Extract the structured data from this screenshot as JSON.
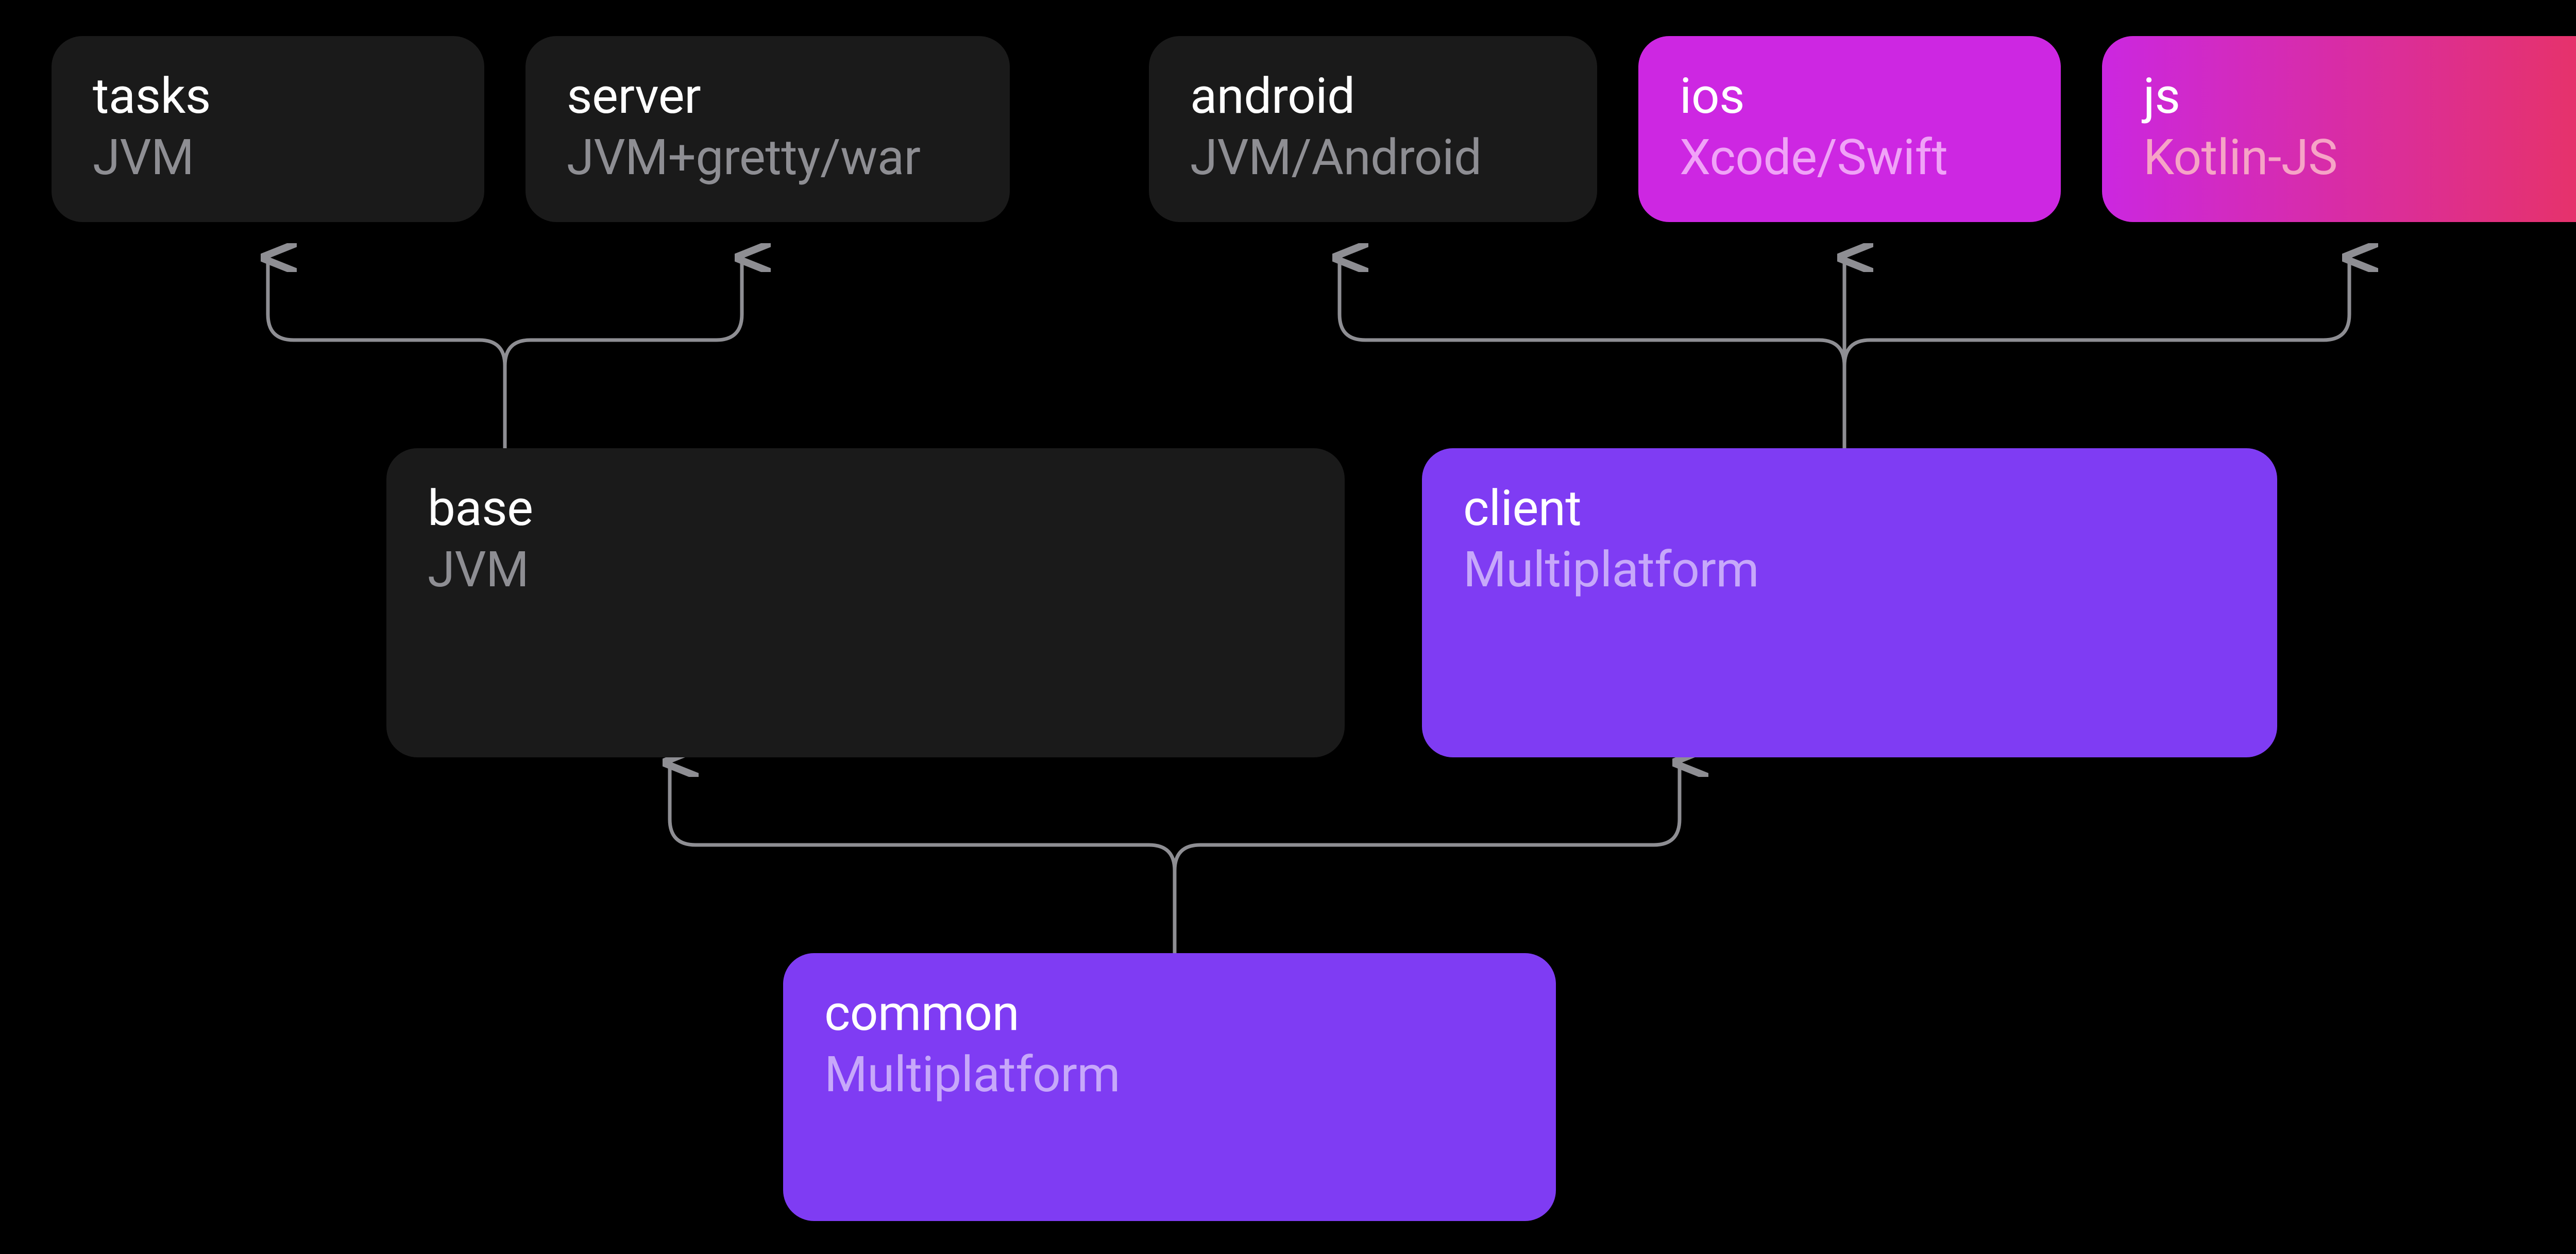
{
  "nodes": {
    "tasks": {
      "title": "tasks",
      "subtitle": "JVM"
    },
    "server": {
      "title": "server",
      "subtitle": "JVM+gretty/war"
    },
    "android": {
      "title": "android",
      "subtitle": "JVM/Android"
    },
    "ios": {
      "title": "ios",
      "subtitle": "Xcode/Swift"
    },
    "js": {
      "title": "js",
      "subtitle": "Kotlin-JS"
    },
    "base": {
      "title": "base",
      "subtitle": "JVM"
    },
    "client": {
      "title": "client",
      "subtitle": "Multiplatform"
    },
    "common": {
      "title": "common",
      "subtitle": "Multiplatform"
    }
  },
  "colors": {
    "dark_bg": "#1a1a1a",
    "purple": "#7f3cf3",
    "magenta": "#cd27e2",
    "gradient_start": "#cb27e0",
    "gradient_end": "#e83360",
    "connector": "#8e8e93"
  }
}
